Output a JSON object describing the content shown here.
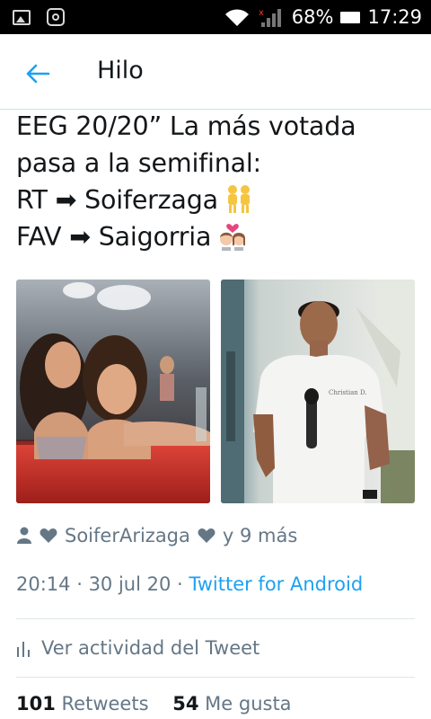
{
  "status_bar": {
    "battery": "68%",
    "time": "17:29"
  },
  "header": {
    "title": "Hilo"
  },
  "tweet": {
    "lines": [
      "EEG 20/20” La más votada",
      "pasa a la semifinal:",
      "RT ➡ Soiferzaga",
      "FAV ➡ Saigorria"
    ]
  },
  "likers": {
    "name": "SoiferArizaga",
    "more": "y 9 más"
  },
  "meta": {
    "time": "20:14",
    "date": "30 jul 20",
    "separator": " · ",
    "source": "Twitter for Android"
  },
  "activity": {
    "label": "Ver actividad del Tweet"
  },
  "stats": {
    "retweets_count": "101",
    "retweets_label": "Retweets",
    "likes_count": "54",
    "likes_label": "Me gusta"
  },
  "colors": {
    "accent": "#1da1f2",
    "text": "#14171a",
    "secondary": "#657786",
    "statusbar": "#000000"
  }
}
